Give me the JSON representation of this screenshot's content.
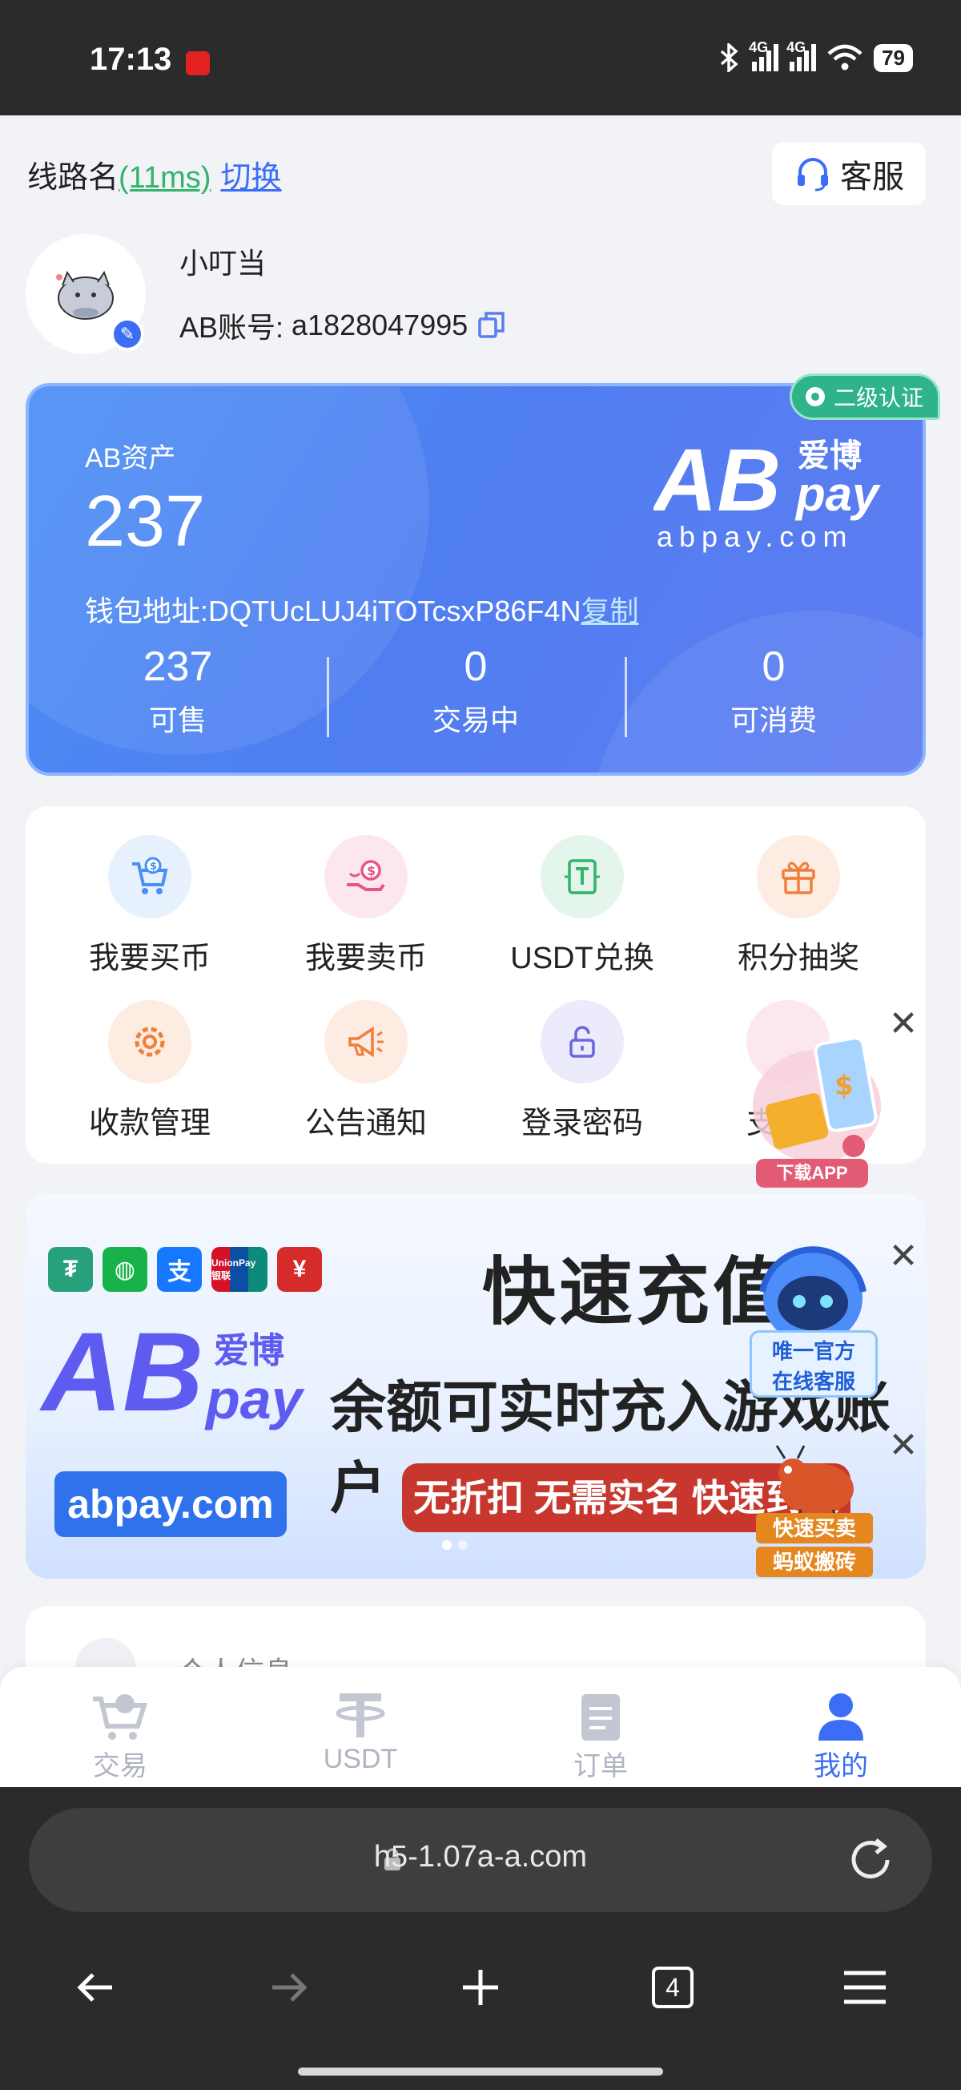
{
  "status_bar": {
    "time": "17:13",
    "net1": "4G",
    "net2": "4G",
    "battery": "79"
  },
  "header": {
    "line_name": "线路名",
    "latency": "(11ms)",
    "switch_label": "切换",
    "cs_label": "客服"
  },
  "profile": {
    "nickname": "小叮当",
    "account_label": "AB账号:",
    "account_id": "a1828047995"
  },
  "asset": {
    "label": "AB资产",
    "value": "237",
    "logo_cn": "爱博",
    "logo_url": "abpay.com",
    "wallet_label": "钱包地址:",
    "wallet_address": "DQTUcLUJ4iTOTcsxP86F4N",
    "copy_label": "复制",
    "stats": [
      {
        "value": "237",
        "label": "可售"
      },
      {
        "value": "0",
        "label": "交易中"
      },
      {
        "value": "0",
        "label": "可消费"
      }
    ],
    "verify_badge": "二级认证"
  },
  "menu": [
    {
      "label": "我要买币",
      "icon": "cart-coin-icon"
    },
    {
      "label": "我要卖币",
      "icon": "hand-coin-icon"
    },
    {
      "label": "USDT兑换",
      "icon": "tether-exchange-icon"
    },
    {
      "label": "积分抽奖",
      "icon": "gift-icon"
    },
    {
      "label": "收款管理",
      "icon": "gear-icon"
    },
    {
      "label": "公告通知",
      "icon": "megaphone-icon"
    },
    {
      "label": "登录密码",
      "icon": "lock-icon"
    },
    {
      "label": "支",
      "icon": "shield-icon"
    }
  ],
  "float_app": {
    "label": "下载APP"
  },
  "banner": {
    "title": "快速充值",
    "subtitle": "余额可实时充入游戏账户",
    "logo_cn": "爱博",
    "url": "abpay.com",
    "tag": "无折扣 无需实名 快速到账",
    "unionpay": "UnionPay 银联"
  },
  "robot": {
    "line1": "唯一官方",
    "line2": "在线客服"
  },
  "ant": {
    "line1": "快速买卖",
    "line2": "蚂蚁搬砖"
  },
  "info_card": {
    "label": "个人信息"
  },
  "tabbar": [
    {
      "label": "交易",
      "active": false
    },
    {
      "label": "USDT",
      "active": false
    },
    {
      "label": "订单",
      "active": false
    },
    {
      "label": "我的",
      "active": true
    }
  ],
  "browser": {
    "url": "h5-1.07a-a.com",
    "tab_count": "4"
  },
  "colors": {
    "accent": "#3b6ef5",
    "card_start": "#4a8ff5",
    "card_end": "#5f7cf2",
    "verify": "#2fb38a"
  }
}
